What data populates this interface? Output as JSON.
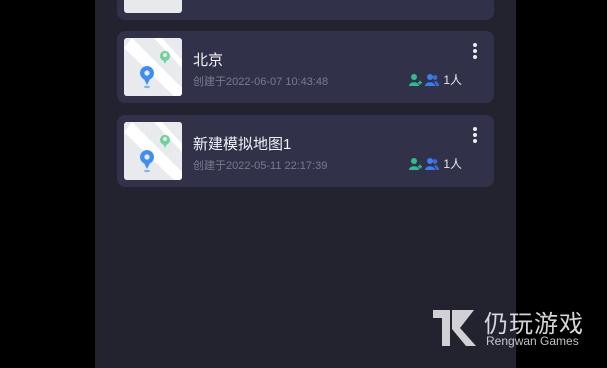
{
  "maps": [
    {
      "title": "北京",
      "created": "创建于2022-06-07 10:43:48",
      "member_count": "1人",
      "thumb_icon": "map-pin-icon",
      "more_icon": "more-vertical-icon"
    },
    {
      "title": "新建模拟地图1",
      "created": "创建于2022-05-11 22:17:39",
      "member_count": "1人",
      "thumb_icon": "map-pin-icon",
      "more_icon": "more-vertical-icon"
    }
  ],
  "watermark": {
    "name_cn": "仍玩游戏",
    "name_en": "Rengwan Games"
  },
  "colors": {
    "background": "#23232f",
    "card": "#31314a",
    "pin_blue": "#3d8ef0",
    "pin_green": "#4fce8c",
    "member_green": "#2fbf8a",
    "member_blue": "#3b7cf0"
  }
}
